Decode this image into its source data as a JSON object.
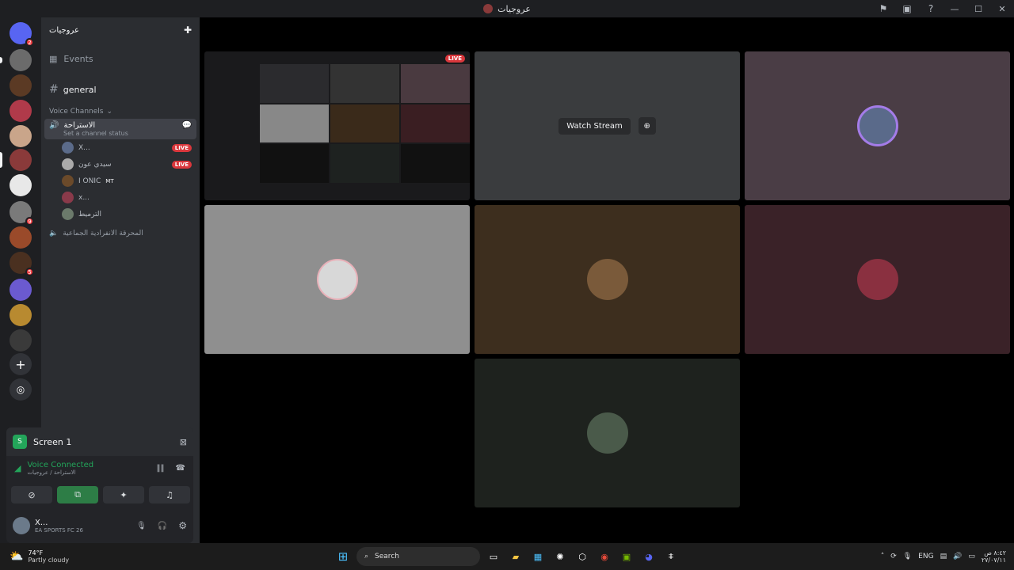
{
  "window": {
    "title": "عروجيات"
  },
  "server": {
    "name": "عروجيات"
  },
  "channels": {
    "events_label": "Events",
    "text_channel": "general",
    "voice_section": "Voice Channels",
    "active_voice": "الاستراحة",
    "channel_status_placeholder": "Set a channel status",
    "users": [
      {
        "name": "X...",
        "live": "LIVE"
      },
      {
        "name": "سيدي عون",
        "live": "LIVE"
      },
      {
        "name": "I ONIC",
        "tag": "MT"
      },
      {
        "name": "x..."
      },
      {
        "name": "الترميط"
      }
    ],
    "other_voice": "المحرقة الانفرادية الجماعية"
  },
  "screen_share": {
    "label": "Screen 1"
  },
  "voice": {
    "status": "Voice Connected",
    "location": "الاستراحة / عروجيات"
  },
  "user": {
    "name": "X...",
    "activity": "EA SPORTS FC 26"
  },
  "stage": {
    "live_badge": "LIVE",
    "watch_stream": "Watch Stream"
  },
  "taskbar": {
    "weather_temp": "74°F",
    "weather_desc": "Partly cloudy",
    "search": "Search",
    "lang": "ENG",
    "time": "٨:٤٢ ص",
    "date": "٢٧/٠٧/١١"
  },
  "server_badges": [
    "2",
    "9",
    "5"
  ]
}
